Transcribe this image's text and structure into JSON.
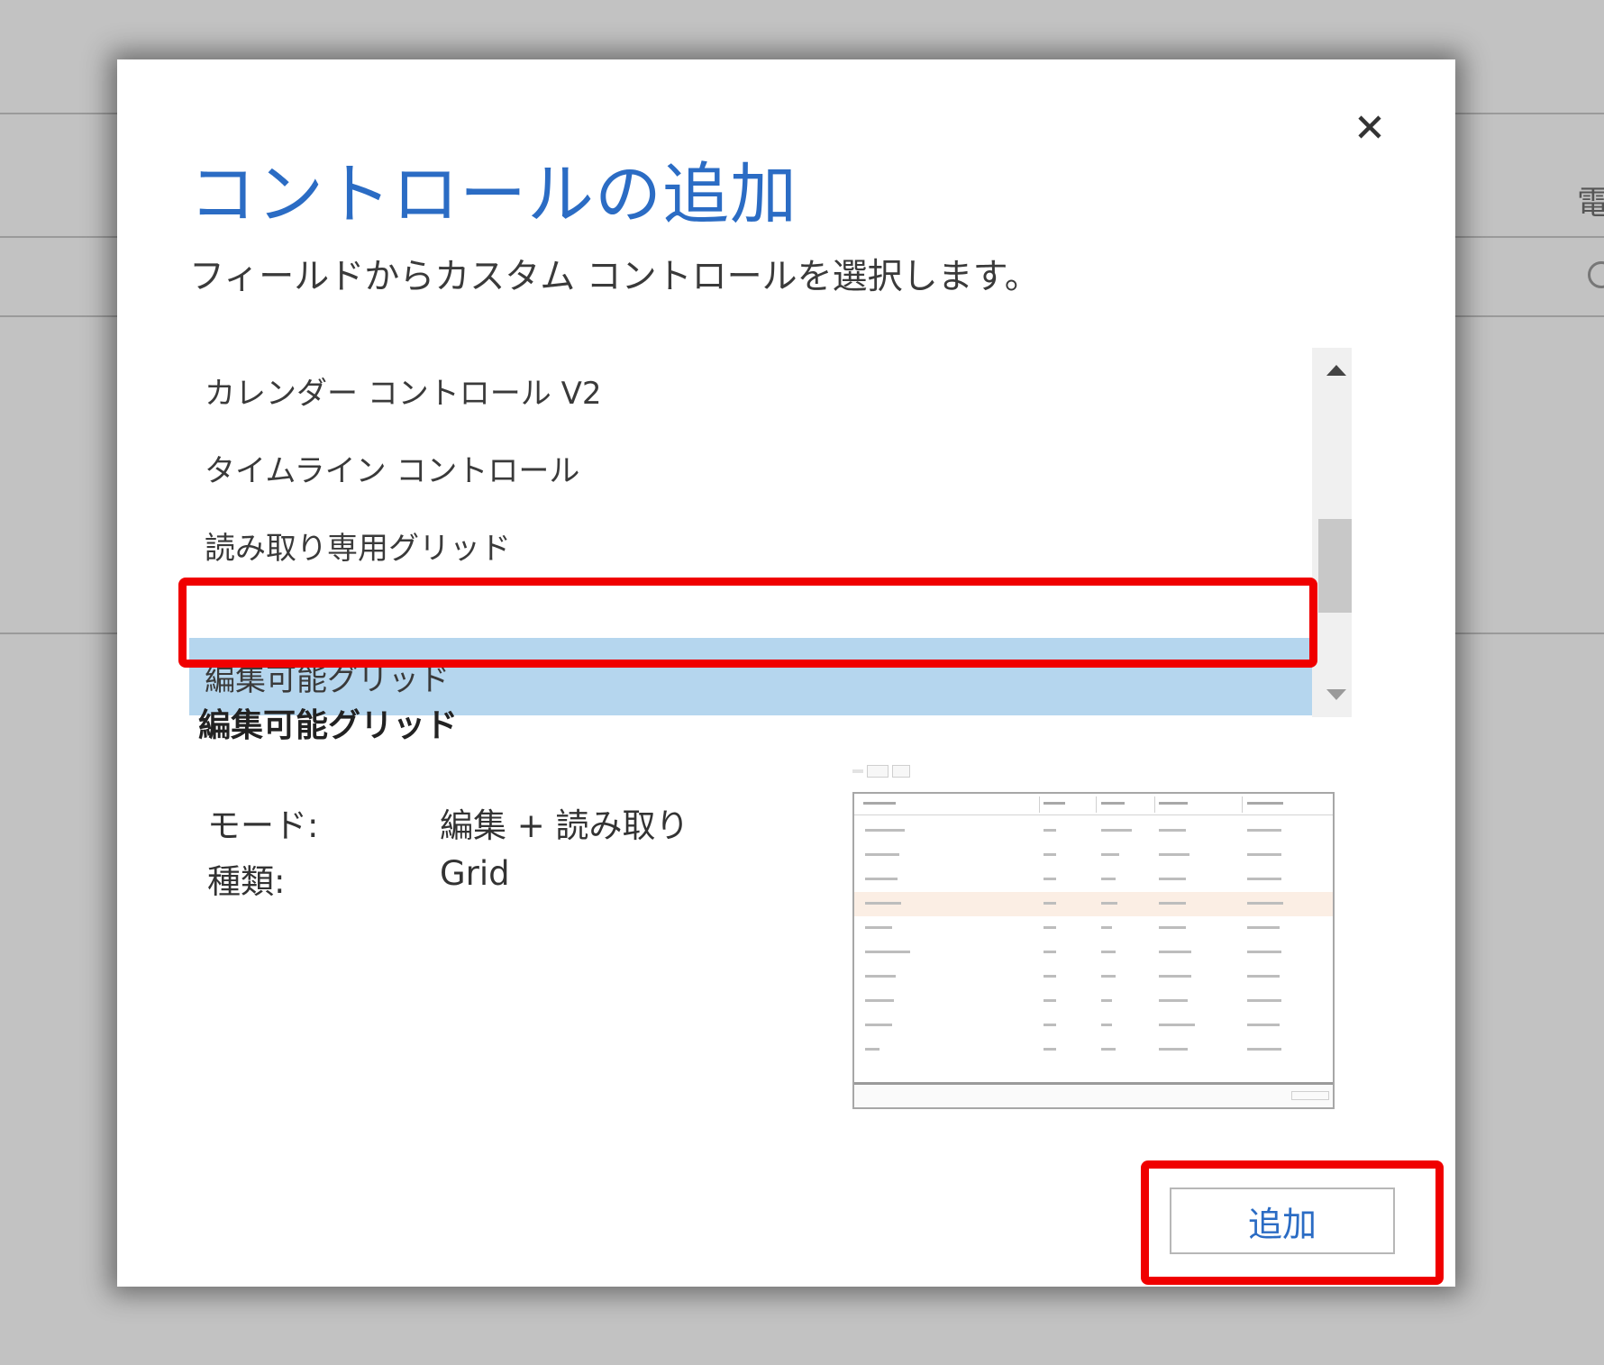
{
  "dialog": {
    "title": "コントロールの追加",
    "subtitle": "フィールドからカスタム コントロールを選択します。",
    "close_icon": "close-icon",
    "accent_color": "#2b6cc4",
    "highlight_color": "#f00000",
    "selected_color": "#b5d6ee"
  },
  "list": {
    "items": [
      {
        "label": "カレンダー コントロール V2"
      },
      {
        "label": "タイムライン コントロール"
      },
      {
        "label": "読み取り専用グリッド"
      },
      {
        "label": "編集可能グリッド",
        "selected": true
      }
    ]
  },
  "details": {
    "heading": "編集可能グリッド",
    "mode_label": "モード:",
    "mode_value": "編集 + 読み取り",
    "type_label": "種類:",
    "type_value": "Grid"
  },
  "preview": {
    "alt": "editable-grid-preview-thumbnail"
  },
  "footer": {
    "add_label": "追加"
  },
  "background": {
    "edge_glyph": "電"
  }
}
